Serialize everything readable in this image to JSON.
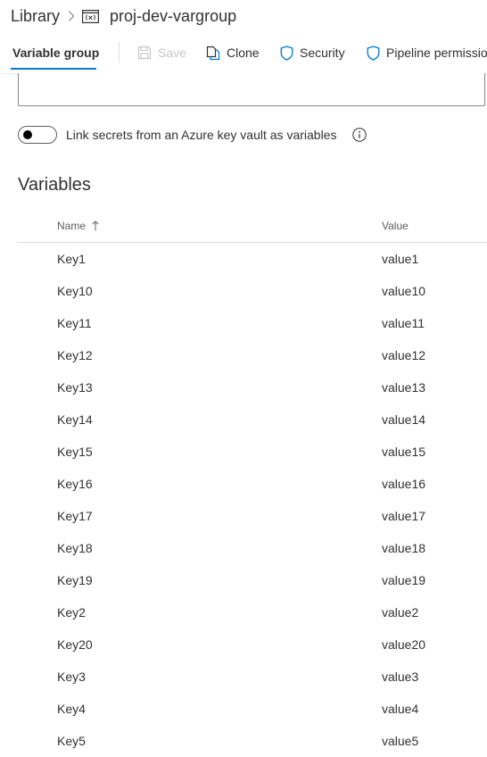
{
  "breadcrumb": {
    "library_label": "Library",
    "title": "proj-dev-vargroup"
  },
  "toolbar": {
    "tab_label": "Variable group",
    "save_label": "Save",
    "clone_label": "Clone",
    "security_label": "Security",
    "pipeline_label": "Pipeline permissio"
  },
  "keyvault": {
    "toggle_label": "Link secrets from an Azure key vault as variables",
    "toggle_on": false
  },
  "variables": {
    "title": "Variables",
    "columns": {
      "name": "Name",
      "value": "Value"
    },
    "rows": [
      {
        "name": "Key1",
        "value": "value1"
      },
      {
        "name": "Key10",
        "value": "value10"
      },
      {
        "name": "Key11",
        "value": "value11"
      },
      {
        "name": "Key12",
        "value": "value12"
      },
      {
        "name": "Key13",
        "value": "value13"
      },
      {
        "name": "Key14",
        "value": "value14"
      },
      {
        "name": "Key15",
        "value": "value15"
      },
      {
        "name": "Key16",
        "value": "value16"
      },
      {
        "name": "Key17",
        "value": "value17"
      },
      {
        "name": "Key18",
        "value": "value18"
      },
      {
        "name": "Key19",
        "value": "value19"
      },
      {
        "name": "Key2",
        "value": "value2"
      },
      {
        "name": "Key20",
        "value": "value20"
      },
      {
        "name": "Key3",
        "value": "value3"
      },
      {
        "name": "Key4",
        "value": "value4"
      },
      {
        "name": "Key5",
        "value": "value5"
      }
    ]
  },
  "colors": {
    "accent": "#0078d4",
    "text": "#323130",
    "disabled": "#c8c6c4"
  },
  "icons": {
    "breadcrumb_separator": "chevron-right-icon",
    "variable_group": "variable-group-icon",
    "save": "save-icon",
    "clone": "clone-icon",
    "security": "shield-icon",
    "pipeline": "shield-icon",
    "info": "info-icon",
    "sort": "arrow-up-icon"
  }
}
